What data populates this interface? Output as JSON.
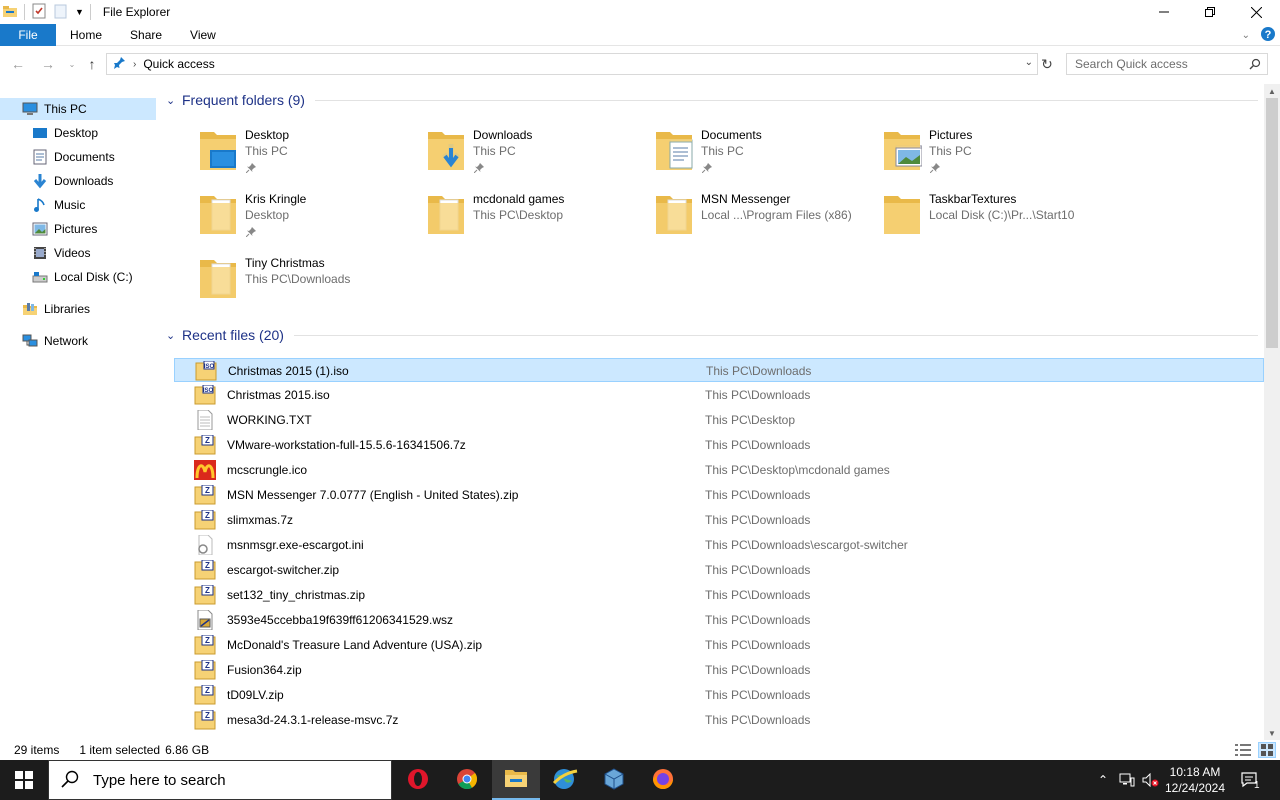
{
  "window": {
    "title": "File Explorer"
  },
  "ribbon": {
    "tabs": [
      "File",
      "Home",
      "Share",
      "View"
    ]
  },
  "address": {
    "path": "Quick access",
    "search_placeholder": "Search Quick access"
  },
  "nav": {
    "items": [
      {
        "label": "This PC",
        "icon": "computer-icon",
        "level": 0,
        "selected": true
      },
      {
        "label": "Desktop",
        "icon": "desktop-icon",
        "level": 1
      },
      {
        "label": "Documents",
        "icon": "documents-icon",
        "level": 1
      },
      {
        "label": "Downloads",
        "icon": "downloads-icon",
        "level": 1
      },
      {
        "label": "Music",
        "icon": "music-icon",
        "level": 1
      },
      {
        "label": "Pictures",
        "icon": "pictures-icon",
        "level": 1
      },
      {
        "label": "Videos",
        "icon": "videos-icon",
        "level": 1
      },
      {
        "label": "Local Disk (C:)",
        "icon": "drive-icon",
        "level": 1
      },
      {
        "label": "Libraries",
        "icon": "libraries-icon",
        "level": 0
      },
      {
        "label": "Network",
        "icon": "network-icon",
        "level": 0
      }
    ]
  },
  "frequent": {
    "header": "Frequent folders (9)",
    "folders": [
      {
        "name": "Desktop",
        "location": "This PC",
        "pinned": true,
        "overlay": "desktop"
      },
      {
        "name": "Downloads",
        "location": "This PC",
        "pinned": true,
        "overlay": "downloads"
      },
      {
        "name": "Documents",
        "location": "This PC",
        "pinned": true,
        "overlay": "documents"
      },
      {
        "name": "Pictures",
        "location": "This PC",
        "pinned": true,
        "overlay": "pictures"
      },
      {
        "name": "Kris Kringle",
        "location": "Desktop",
        "pinned": true,
        "overlay": "paper"
      },
      {
        "name": "mcdonald games",
        "location": "This PC\\Desktop",
        "pinned": false,
        "overlay": "paper"
      },
      {
        "name": "MSN Messenger",
        "location": "Local ...\\Program Files (x86)",
        "pinned": false,
        "overlay": "paper"
      },
      {
        "name": "TaskbarTextures",
        "location": "Local Disk (C:)\\Pr...\\Start10",
        "pinned": false,
        "overlay": "none"
      },
      {
        "name": "Tiny Christmas",
        "location": "This PC\\Downloads",
        "pinned": false,
        "overlay": "paper"
      }
    ]
  },
  "recent": {
    "header": "Recent files (20)",
    "files": [
      {
        "name": "Christmas 2015 (1).iso",
        "location": "This PC\\Downloads",
        "icon": "iso",
        "selected": true
      },
      {
        "name": "Christmas 2015.iso",
        "location": "This PC\\Downloads",
        "icon": "iso"
      },
      {
        "name": "WORKING.TXT",
        "location": "This PC\\Desktop",
        "icon": "txt"
      },
      {
        "name": "VMware-workstation-full-15.5.6-16341506.7z",
        "location": "This PC\\Downloads",
        "icon": "archive"
      },
      {
        "name": "mcscrungle.ico",
        "location": "This PC\\Desktop\\mcdonald games",
        "icon": "mcd"
      },
      {
        "name": "MSN Messenger 7.0.0777 (English - United States).zip",
        "location": "This PC\\Downloads",
        "icon": "archive"
      },
      {
        "name": "slimxmas.7z",
        "location": "This PC\\Downloads",
        "icon": "archive"
      },
      {
        "name": "msnmsgr.exe-escargot.ini",
        "location": "This PC\\Downloads\\escargot-switcher",
        "icon": "ini"
      },
      {
        "name": "escargot-switcher.zip",
        "location": "This PC\\Downloads",
        "icon": "archive"
      },
      {
        "name": "set132_tiny_christmas.zip",
        "location": "This PC\\Downloads",
        "icon": "archive"
      },
      {
        "name": "3593e45ccebba19f639ff61206341529.wsz",
        "location": "This PC\\Downloads",
        "icon": "wsz"
      },
      {
        "name": "McDonald's Treasure Land Adventure (USA).zip",
        "location": "This PC\\Downloads",
        "icon": "archive"
      },
      {
        "name": "Fusion364.zip",
        "location": "This PC\\Downloads",
        "icon": "archive"
      },
      {
        "name": "tD09LV.zip",
        "location": "This PC\\Downloads",
        "icon": "archive"
      },
      {
        "name": "mesa3d-24.3.1-release-msvc.7z",
        "location": "This PC\\Downloads",
        "icon": "archive"
      }
    ]
  },
  "status": {
    "items": "29 items",
    "selected": "1 item selected",
    "size": "6.86 GB"
  },
  "taskbar": {
    "search_placeholder": "Type here to search",
    "apps": [
      "opera-icon",
      "chrome-icon",
      "file-explorer-icon",
      "globe-app-icon",
      "virtualbox-icon",
      "firefox-icon"
    ],
    "time": "10:18 AM",
    "date": "12/24/2024",
    "notification_count": "1"
  },
  "colors": {
    "accent": "#1979ca",
    "selection": "#cce8ff",
    "selection_border": "#99d1ff",
    "group_header": "#1e3287",
    "folder": "#f6d275",
    "taskbar": "#1c1c1c"
  }
}
